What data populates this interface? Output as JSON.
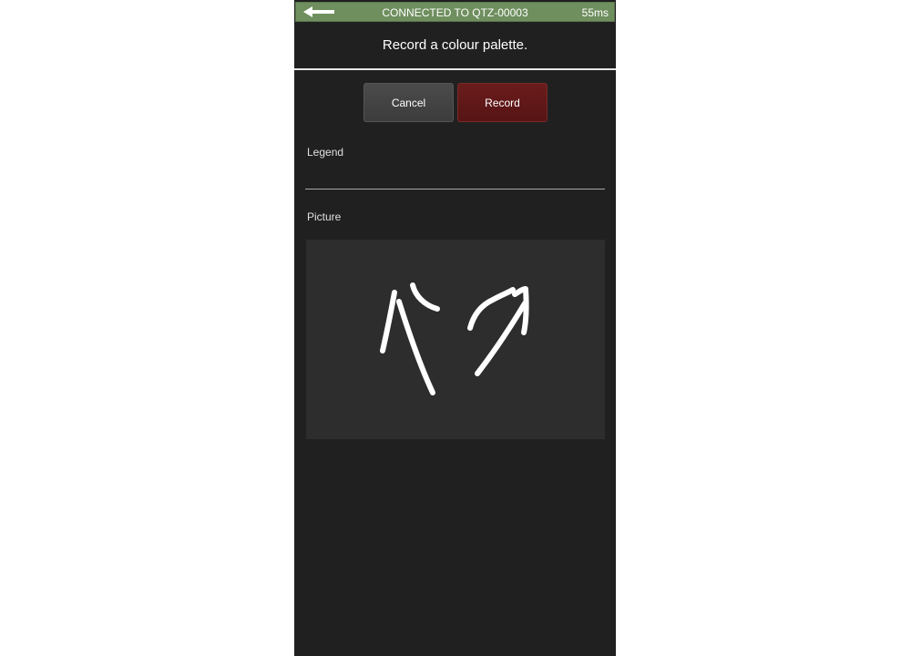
{
  "status_bar": {
    "back_icon": "arrow-left-icon",
    "connection_text": "CONNECTED TO QTZ-00003",
    "latency": "55ms",
    "color": "#6f8f5e"
  },
  "page": {
    "title": "Record a colour palette."
  },
  "actions": {
    "cancel_label": "Cancel",
    "record_label": "Record",
    "record_color": "#5f1818"
  },
  "form": {
    "legend_label": "Legend",
    "legend_value": "",
    "picture_label": "Picture"
  }
}
